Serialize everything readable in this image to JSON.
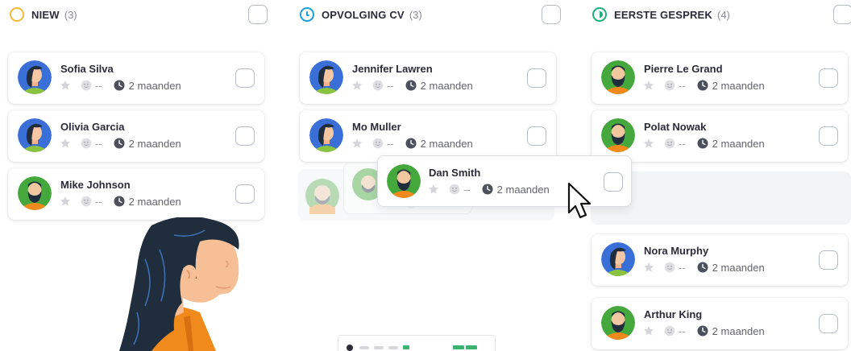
{
  "columns": [
    {
      "title": "NIEW",
      "count": "(3)",
      "status_color": "#f2b93b",
      "cards": [
        {
          "name": "Sofia Silva",
          "rating": "--",
          "duration": "2 maanden",
          "avatar": "woman"
        },
        {
          "name": "Olivia Garcia",
          "rating": "--",
          "duration": "2 maanden",
          "avatar": "woman"
        },
        {
          "name": "Mike Johnson",
          "rating": "--",
          "duration": "2 maanden",
          "avatar": "man"
        }
      ]
    },
    {
      "title": "OPVOLGING CV",
      "count": "(3)",
      "status_color": "#1ba0d8",
      "cards": [
        {
          "name": "Jennifer Lawren",
          "rating": "--",
          "duration": "2 maanden",
          "avatar": "woman"
        },
        {
          "name": "Mo Muller",
          "rating": "--",
          "duration": "2 maanden",
          "avatar": "woman"
        }
      ]
    },
    {
      "title": "EERSTE GESPREK",
      "count": "(4)",
      "status_color": "#1fb07a",
      "cards": [
        {
          "name": "Pierre Le Grand",
          "rating": "--",
          "duration": "2 maanden",
          "avatar": "man"
        },
        {
          "name": "Polat Nowak",
          "rating": "--",
          "duration": "2 maanden",
          "avatar": "man"
        },
        {
          "name": "Nora Murphy",
          "rating": "--",
          "duration": "2 maanden",
          "avatar": "woman"
        },
        {
          "name": "Arthur King",
          "rating": "--",
          "duration": "2 maanden",
          "avatar": "man"
        }
      ]
    }
  ],
  "dragged_card": {
    "name": "Dan Smith",
    "rating": "--",
    "duration": "2 maanden",
    "avatar": "man"
  },
  "icons": {
    "star": "star-icon",
    "rating": "smiley-icon",
    "time": "clock-icon",
    "cursor": "mouse-pointer-icon"
  },
  "colors": {
    "avatar_blue": "#3a6fd8",
    "avatar_green": "#44a83c",
    "shirt_green": "#8ac33f",
    "shirt_orange": "#f08a1c",
    "hair": "#1f2d3d"
  }
}
